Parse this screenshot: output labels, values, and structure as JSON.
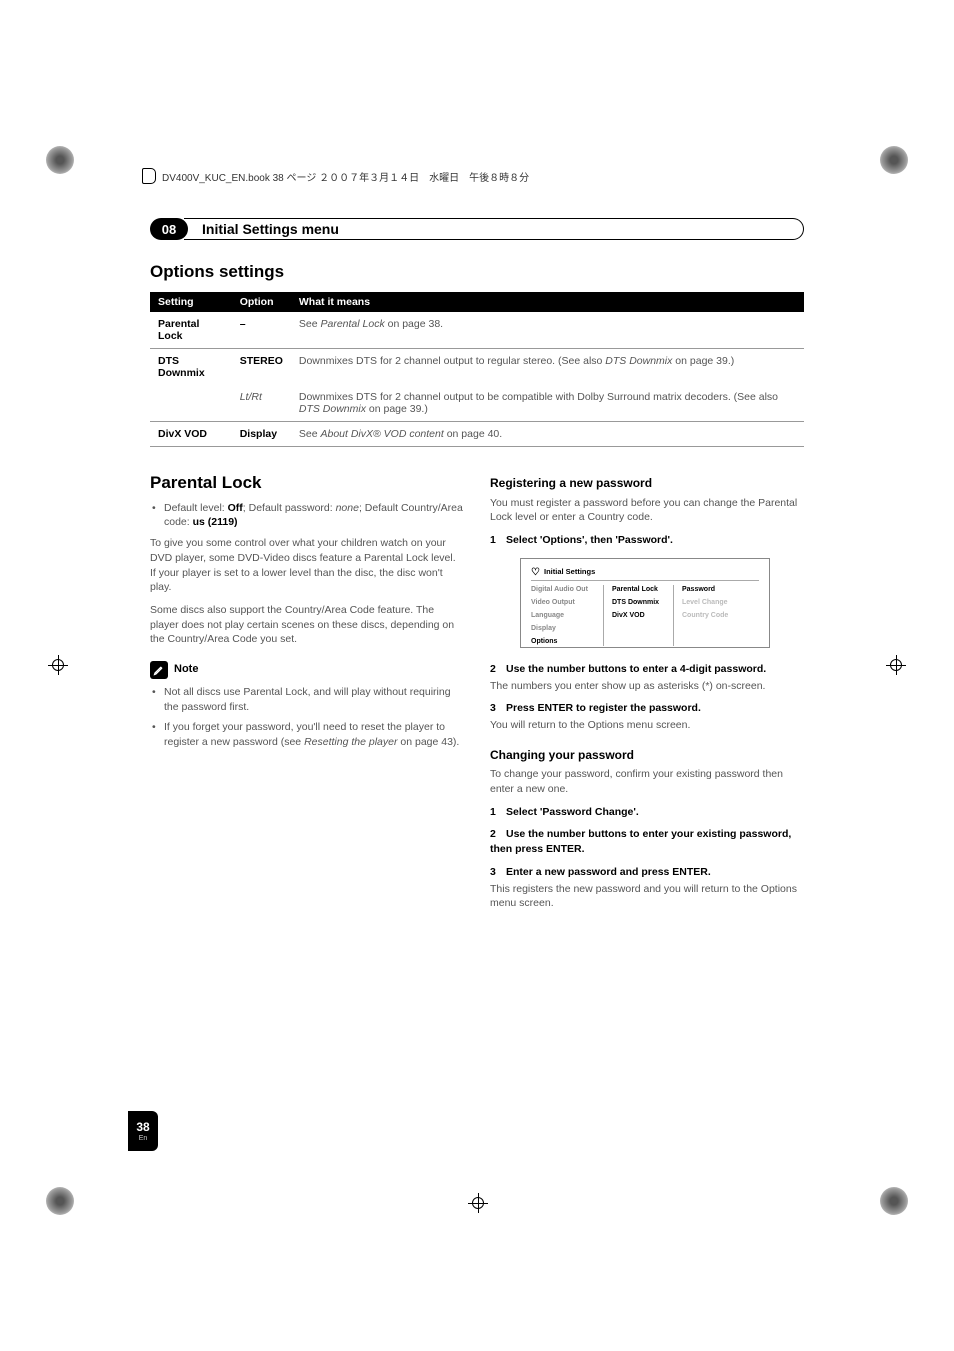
{
  "header_line": "DV400V_KUC_EN.book 38 ページ ２００７年３月１４日　水曜日　午後８時８分",
  "chapter_number": "08",
  "chapter_title": "Initial Settings menu",
  "section_title": "Options settings",
  "table": {
    "headers": [
      "Setting",
      "Option",
      "What it means"
    ],
    "rows": [
      {
        "setting": "Parental Lock",
        "option": "–",
        "meaning_prefix": "See ",
        "meaning_italic": "Parental Lock",
        "meaning_suffix": " on page 38."
      },
      {
        "setting": "DTS Downmix",
        "option": "STEREO",
        "meaning_prefix": "Downmixes DTS for 2 channel output to regular stereo. (See also ",
        "meaning_italic": "DTS Downmix",
        "meaning_suffix": " on page 39.)"
      },
      {
        "setting": "",
        "option_italic": "Lt/Rt",
        "meaning_prefix": "Downmixes DTS for 2 channel output to be compatible with Dolby Surround matrix decoders. (See also ",
        "meaning_italic": "DTS Downmix",
        "meaning_suffix": " on page 39.)"
      },
      {
        "setting": "DivX VOD",
        "option": "Display",
        "meaning_prefix": "See ",
        "meaning_italic": "About DivX® VOD content",
        "meaning_suffix": " on page 40."
      }
    ]
  },
  "left": {
    "h2": "Parental Lock",
    "bullet1_a": "Default level: ",
    "bullet1_b": "Off",
    "bullet1_c": "; Default password: ",
    "bullet1_d": "none",
    "bullet1_e": "; Default Country/Area code: ",
    "bullet1_f": "us (2119)",
    "p1": "To give you some control over what your children watch on your DVD player, some DVD-Video discs feature a Parental Lock level. If your player is set to a lower level than the disc, the disc won't play.",
    "p2": "Some discs also support the Country/Area Code feature. The player does not play certain scenes on these discs, depending on the Country/Area Code you set.",
    "note_label": "Note",
    "note_b1": "Not all discs use Parental Lock, and will play without requiring the password first.",
    "note_b2_a": "If you forget your password, you'll need to reset the player to register a new password (see ",
    "note_b2_b": "Resetting the player",
    "note_b2_c": " on page 43)."
  },
  "right": {
    "h3a": "Registering a new password",
    "p1": "You must register a password before you can change the Parental Lock level or enter a Country code.",
    "step1": "Select 'Options', then 'Password'.",
    "ss": {
      "title": "Initial Settings",
      "col1": [
        "Digital Audio Out",
        "Video Output",
        "Language",
        "Display",
        "Options"
      ],
      "col2": [
        "Parental Lock",
        "DTS Downmix",
        "DivX VOD"
      ],
      "col3": [
        "Password",
        "Level Change",
        "Country Code"
      ]
    },
    "step2": "Use the number buttons to enter a 4-digit password.",
    "p2": "The numbers you enter show up as asterisks (*) on-screen.",
    "step3": "Press ENTER to register the password.",
    "p3": "You will return to the Options menu screen.",
    "h3b": "Changing your password",
    "p4": "To change your password, confirm your existing password then enter a new one.",
    "cstep1": "Select 'Password Change'.",
    "cstep2": "Use the number buttons to enter your existing password, then press ENTER.",
    "cstep3": "Enter a new password and press ENTER.",
    "p5": "This registers the new password and you will return to the Options menu screen."
  },
  "page_number": "38",
  "page_lang": "En"
}
